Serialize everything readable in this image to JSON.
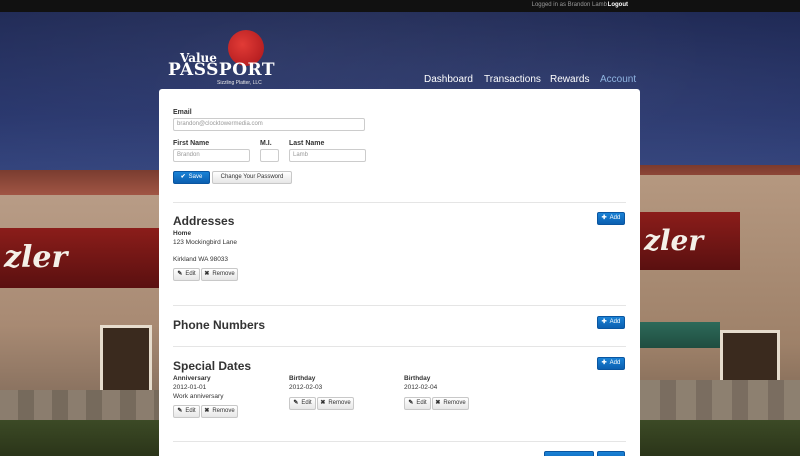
{
  "topbar": {
    "logged_in_text": "Logged in as Brandon Lamb",
    "logout_label": "Logout"
  },
  "logo": {
    "value": "Value",
    "passport": "PASSPORT",
    "sub": "Sizzling Platter, LLC"
  },
  "background": {
    "sign_text": "zler"
  },
  "nav": [
    {
      "label": "Dashboard",
      "active": false
    },
    {
      "label": "Transactions",
      "active": false
    },
    {
      "label": "Rewards",
      "active": false
    },
    {
      "label": "Account",
      "active": true
    }
  ],
  "form": {
    "email_label": "Email",
    "email_value": "brandon@clocktowermedia.com",
    "first_name_label": "First Name",
    "first_name_value": "Brandon",
    "mi_label": "M.I.",
    "mi_value": "",
    "last_name_label": "Last Name",
    "last_name_value": "Lamb",
    "save_label": "Save",
    "change_password_label": "Change Your Password"
  },
  "addresses": {
    "title": "Addresses",
    "add_label": "Add",
    "items": [
      {
        "name": "Home",
        "line1": "123 Mockingbird Lane",
        "line2": "Kirkland WA 98033"
      }
    ]
  },
  "phone": {
    "title": "Phone Numbers",
    "add_label": "Add"
  },
  "special_dates": {
    "title": "Special Dates",
    "add_label": "Add",
    "items": [
      {
        "type": "Anniversary",
        "date": "2012-01-01",
        "note": "Work anniversary"
      },
      {
        "type": "Birthday",
        "date": "2012-02-03",
        "note": ""
      },
      {
        "type": "Birthday",
        "date": "2012-02-04",
        "note": ""
      }
    ]
  },
  "actions": {
    "edit_label": "Edit",
    "remove_label": "Remove"
  },
  "icons": {
    "save": "check-icon",
    "add": "plus-icon",
    "edit": "pencil-icon",
    "remove": "x-icon"
  },
  "colors": {
    "primary": "#0b5fb0",
    "nav_active": "#8fb4e0",
    "topbar": "#111111"
  }
}
